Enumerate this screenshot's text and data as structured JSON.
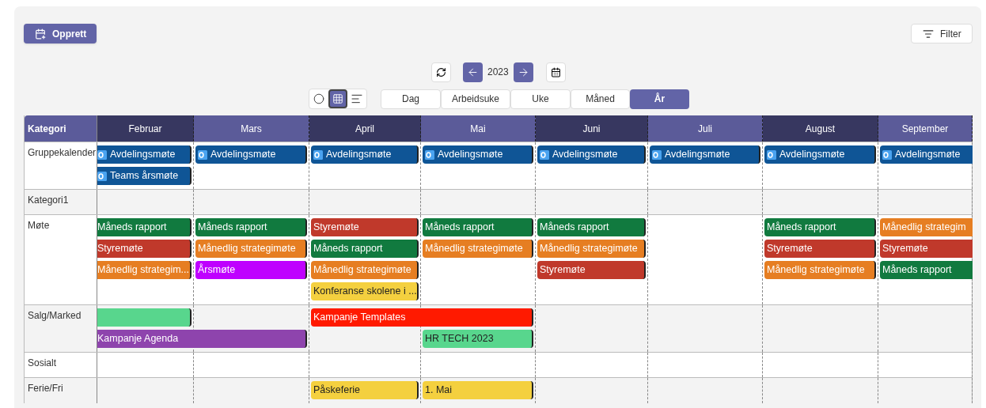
{
  "toolbar": {
    "create_button": "Opprett",
    "filter_button": "Filter"
  },
  "navigation": {
    "year": "2023"
  },
  "view_modes": [
    {
      "kind": "circle",
      "selected": false
    },
    {
      "kind": "grid",
      "selected": true
    },
    {
      "kind": "list",
      "selected": false
    }
  ],
  "range_tabs": [
    {
      "label": "Dag",
      "selected": false
    },
    {
      "label": "Arbeidsuke",
      "selected": false
    },
    {
      "label": "Uke",
      "selected": false
    },
    {
      "label": "Måned",
      "selected": false
    },
    {
      "label": "År",
      "selected": true
    }
  ],
  "table": {
    "category_header": "Kategori",
    "months": [
      "Februar",
      "Mars",
      "April",
      "Mai",
      "Juni",
      "Juli",
      "August",
      "September"
    ],
    "rows": [
      {
        "category": "Gruppekalender",
        "lanes": [
          [
            {
              "kind": "outlook",
              "title": "Avdelingsmøte",
              "color": "#0f5596"
            },
            {
              "kind": "outlook",
              "title": "Avdelingsmøte",
              "color": "#0f5596"
            },
            {
              "kind": "outlook",
              "title": "Avdelingsmøte",
              "color": "#0f5596"
            },
            {
              "kind": "outlook",
              "title": "Avdelingsmøte",
              "color": "#0f5596"
            },
            {
              "kind": "outlook",
              "title": "Avdelingsmøte",
              "color": "#0f5596"
            },
            {
              "kind": "outlook",
              "title": "Avdelingsmøte",
              "color": "#0f5596"
            },
            {
              "kind": "outlook",
              "title": "Avdelingsmøte",
              "color": "#0f5596"
            },
            {
              "kind": "outlook",
              "title": "Avdelingsmøte",
              "color": "#0f5596"
            }
          ],
          [
            {
              "kind": "outlook",
              "title": "Teams årsmøte",
              "color": "#0f5596"
            }
          ]
        ]
      },
      {
        "category": "Kategori1",
        "lanes": []
      },
      {
        "category": "Møte",
        "lanes": [
          [
            {
              "kind": "event",
              "title": "Måneds rapport",
              "color": "#117a3f"
            },
            {
              "kind": "event",
              "title": "Måneds rapport",
              "color": "#117a3f"
            },
            {
              "kind": "event",
              "title": "Styremøte",
              "color": "#c0392b"
            },
            {
              "kind": "event",
              "title": "Måneds rapport",
              "color": "#117a3f"
            },
            {
              "kind": "event",
              "title": "Måneds rapport",
              "color": "#117a3f"
            },
            {
              "kind": "gap"
            },
            {
              "kind": "event",
              "title": "Måneds rapport",
              "color": "#117a3f"
            },
            {
              "kind": "event",
              "title": "Månedlig strategim",
              "color": "#e67e22"
            }
          ],
          [
            {
              "kind": "event",
              "title": "Styremøte",
              "color": "#c0392b"
            },
            {
              "kind": "event",
              "title": "Månedlig strategimøte",
              "color": "#e67e22"
            },
            {
              "kind": "event",
              "title": "Måneds rapport",
              "color": "#117a3f"
            },
            {
              "kind": "event",
              "title": "Månedlig strategimøte",
              "color": "#e67e22"
            },
            {
              "kind": "event",
              "title": "Månedlig strategimøte",
              "color": "#e67e22"
            },
            {
              "kind": "gap"
            },
            {
              "kind": "event",
              "title": "Styremøte",
              "color": "#c0392b"
            },
            {
              "kind": "event",
              "title": "Styremøte",
              "color": "#c0392b"
            }
          ],
          [
            {
              "kind": "event",
              "title": "Månedlig strategim...",
              "color": "#e67e22"
            },
            {
              "kind": "event",
              "title": "Årsmøte",
              "color": "#bf00ff"
            },
            {
              "kind": "event",
              "title": "Månedlig strategimøte",
              "color": "#e67e22"
            },
            {
              "kind": "gap"
            },
            {
              "kind": "event",
              "title": "Styremøte",
              "color": "#c0392b"
            },
            {
              "kind": "gap"
            },
            {
              "kind": "event",
              "title": "Månedlig strategimøte",
              "color": "#e67e22"
            },
            {
              "kind": "event",
              "title": "Måneds rapport",
              "color": "#117a3f"
            }
          ],
          [
            {
              "kind": "gap"
            },
            {
              "kind": "gap"
            },
            {
              "kind": "event",
              "title": "Konferanse skolene i ...",
              "color": "#f4d03f"
            }
          ]
        ]
      },
      {
        "category": "Salg/Marked",
        "lanes": [
          [
            {
              "kind": "event",
              "color": "#58d68d"
            },
            {
              "kind": "gap"
            },
            {
              "kind": "long_event",
              "title": "Kampanje Templates",
              "color": "#ff1a00"
            }
          ],
          [
            {
              "kind": "long_event",
              "title": "Kampanje Agenda",
              "color": "#8e44ad"
            },
            {
              "kind": "gap"
            },
            {
              "kind": "event",
              "title": "HR TECH 2023",
              "color": "#58d68d"
            }
          ]
        ]
      },
      {
        "category": "Sosialt",
        "lanes": []
      },
      {
        "category": "Ferie/Fri",
        "lanes": [
          [
            {
              "kind": "gap"
            },
            {
              "kind": "gap"
            },
            {
              "kind": "event",
              "title": "Påskeferie",
              "color": "#f4d03f"
            },
            {
              "kind": "event",
              "title": "1. Mai",
              "color": "#f4d03f"
            }
          ]
        ]
      }
    ]
  }
}
